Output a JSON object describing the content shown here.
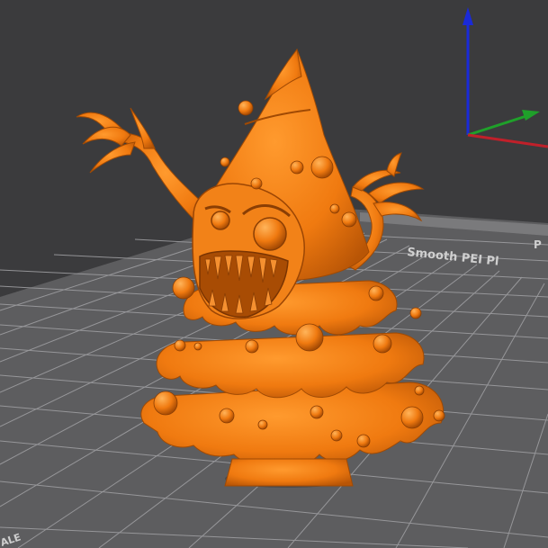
{
  "viewport": {
    "background_color": "#3b3b3d",
    "bed_color": "#5d5d5f",
    "grid_line_color": "#9a9a9c",
    "model_color": "#f07a10"
  },
  "build_plate": {
    "label": "Smooth PEI Pl",
    "label_prefix_fragment": "P",
    "corner_fragment": "ALE"
  },
  "axis_gizmo": {
    "x_axis_color": "#c0202a",
    "y_axis_color": "#1fa02a",
    "z_axis_color": "#1a2ad8"
  },
  "model": {
    "name_icon": "christmas-tree-monster-model"
  }
}
